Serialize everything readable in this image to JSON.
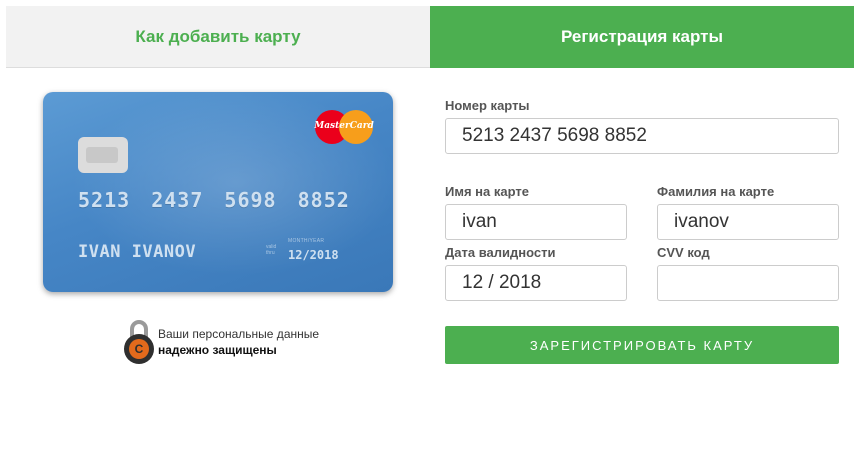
{
  "tabs": {
    "how_to_add": "Как добавить карту",
    "register": "Регистрация карты"
  },
  "card_preview": {
    "number": "5213 2437 5698 8852",
    "holder": "IVAN IVANOV",
    "valid_caption": "valid thru",
    "month_year": "MONTH/YEAR",
    "expiry": "12/2018",
    "brand": "MasterCard"
  },
  "security": {
    "line1": "Ваши персональные данные",
    "line2": "надежно защищены"
  },
  "form": {
    "card_number_label": "Номер карты",
    "card_number_value": "5213 2437 5698 8852",
    "first_name_label": "Имя на карте",
    "first_name_value": "ivan",
    "last_name_label": "Фамилия на карте",
    "last_name_value": "ivanov",
    "expiry_label": "Дата валидности",
    "expiry_value": "12 / 2018",
    "cvv_label": "CVV код",
    "cvv_value": "",
    "submit_label": "ЗАРЕГИСТРИРОВАТЬ КАРТУ"
  },
  "colors": {
    "accent": "#4caf50",
    "card_blue": "#4686c6"
  }
}
